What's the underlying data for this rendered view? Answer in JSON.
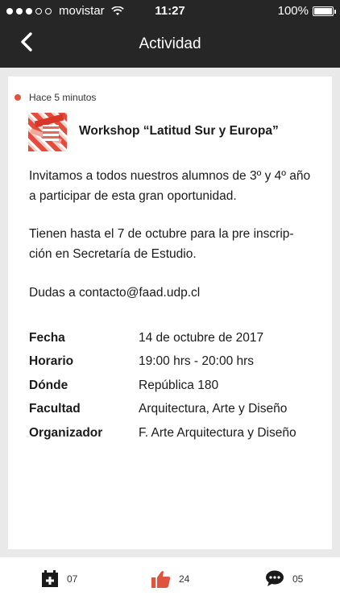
{
  "status_bar": {
    "carrier": "movistar",
    "time": "11:27",
    "battery": "100%"
  },
  "header": {
    "title": "Actividad",
    "back_icon": "chevron-left-icon"
  },
  "post": {
    "timestamp": "Hace 5 minutos",
    "indicator_color": "#e0533f",
    "title": "Workshop “Latitud Sur y Europa”",
    "paragraphs": [
      "Invitamos a todos nuestros alumnos de 3º y 4º año a participar de esta gran oportunidad.",
      "Tienen hasta el 7 de octubre para la pre inscrip-ción en Secretaría de Estudio.",
      "Dudas a contacto@faad.udp.cl"
    ],
    "details": [
      {
        "label": "Fecha",
        "value": "14 de octubre de 2017"
      },
      {
        "label": "Horario",
        "value": "19:00 hrs - 20:00 hrs"
      },
      {
        "label": "Dónde",
        "value": "República 180"
      },
      {
        "label": "Facultad",
        "value": "Arquitectura, Arte y Diseño"
      },
      {
        "label": "Organizador",
        "value": "F. Arte Arquitectura y Diseño"
      }
    ]
  },
  "actions": {
    "add_calendar": {
      "icon": "calendar-add-icon",
      "count": "07"
    },
    "like": {
      "icon": "thumbs-up-icon",
      "count": "24",
      "color": "#e0533f"
    },
    "comment": {
      "icon": "speech-bubble-icon",
      "count": "05"
    }
  }
}
